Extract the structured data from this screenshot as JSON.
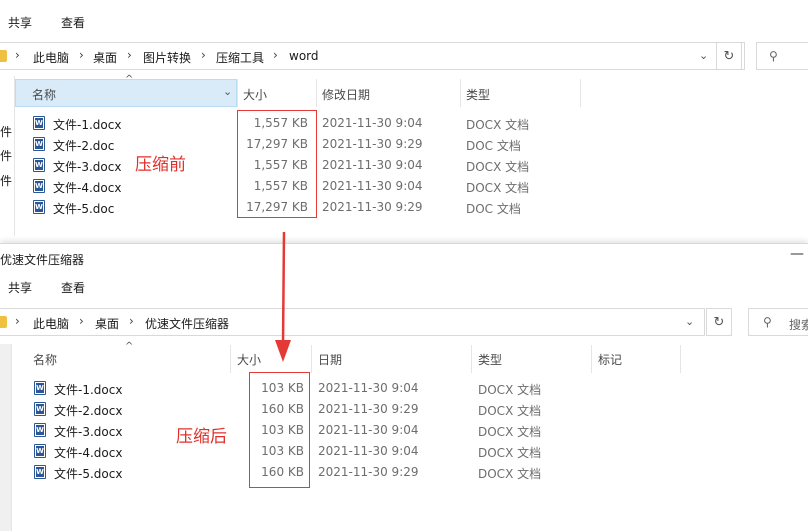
{
  "top": {
    "menu": [
      "共享",
      "查看"
    ],
    "breadcrumb": [
      "此电脑",
      "桌面",
      "图片转换",
      "压缩工具",
      "word"
    ],
    "columns": [
      "名称",
      "大小",
      "修改日期",
      "类型"
    ],
    "left_pane": [
      "件",
      "件",
      "件"
    ],
    "files": [
      {
        "name": "文件-1.docx",
        "size": "1,557 KB",
        "date": "2021-11-30 9:04",
        "type": "DOCX 文档"
      },
      {
        "name": "文件-2.doc",
        "size": "17,297 KB",
        "date": "2021-11-30 9:29",
        "type": "DOC 文档"
      },
      {
        "name": "文件-3.docx",
        "size": "1,557 KB",
        "date": "2021-11-30 9:04",
        "type": "DOCX 文档"
      },
      {
        "name": "文件-4.docx",
        "size": "1,557 KB",
        "date": "2021-11-30 9:04",
        "type": "DOCX 文档"
      },
      {
        "name": "文件-5.doc",
        "size": "17,297 KB",
        "date": "2021-11-30 9:29",
        "type": "DOC 文档"
      }
    ],
    "annotation": "压缩前"
  },
  "bottom": {
    "title": "优速文件压缩器",
    "menu": [
      "共享",
      "查看"
    ],
    "breadcrumb": [
      "此电脑",
      "桌面",
      "优速文件压缩器"
    ],
    "search_placeholder": "搜索",
    "columns": [
      "名称",
      "大小",
      "日期",
      "类型",
      "标记"
    ],
    "files": [
      {
        "name": "文件-1.docx",
        "size": "103 KB",
        "date": "2021-11-30 9:04",
        "type": "DOCX 文档"
      },
      {
        "name": "文件-2.docx",
        "size": "160 KB",
        "date": "2021-11-30 9:29",
        "type": "DOCX 文档"
      },
      {
        "name": "文件-3.docx",
        "size": "103 KB",
        "date": "2021-11-30 9:04",
        "type": "DOCX 文档"
      },
      {
        "name": "文件-4.docx",
        "size": "103 KB",
        "date": "2021-11-30 9:04",
        "type": "DOCX 文档"
      },
      {
        "name": "文件-5.docx",
        "size": "160 KB",
        "date": "2021-11-30 9:29",
        "type": "DOCX 文档"
      }
    ],
    "annotation": "压缩后"
  },
  "colors": {
    "annotation_red": "#e53935",
    "word_blue": "#2b5797",
    "folder_yellow": "#f0c040"
  },
  "icons": [
    "folder-icon",
    "chevron-down-icon",
    "refresh-icon",
    "search-icon",
    "word-doc-icon",
    "sort-up-icon",
    "minimize-icon"
  ]
}
